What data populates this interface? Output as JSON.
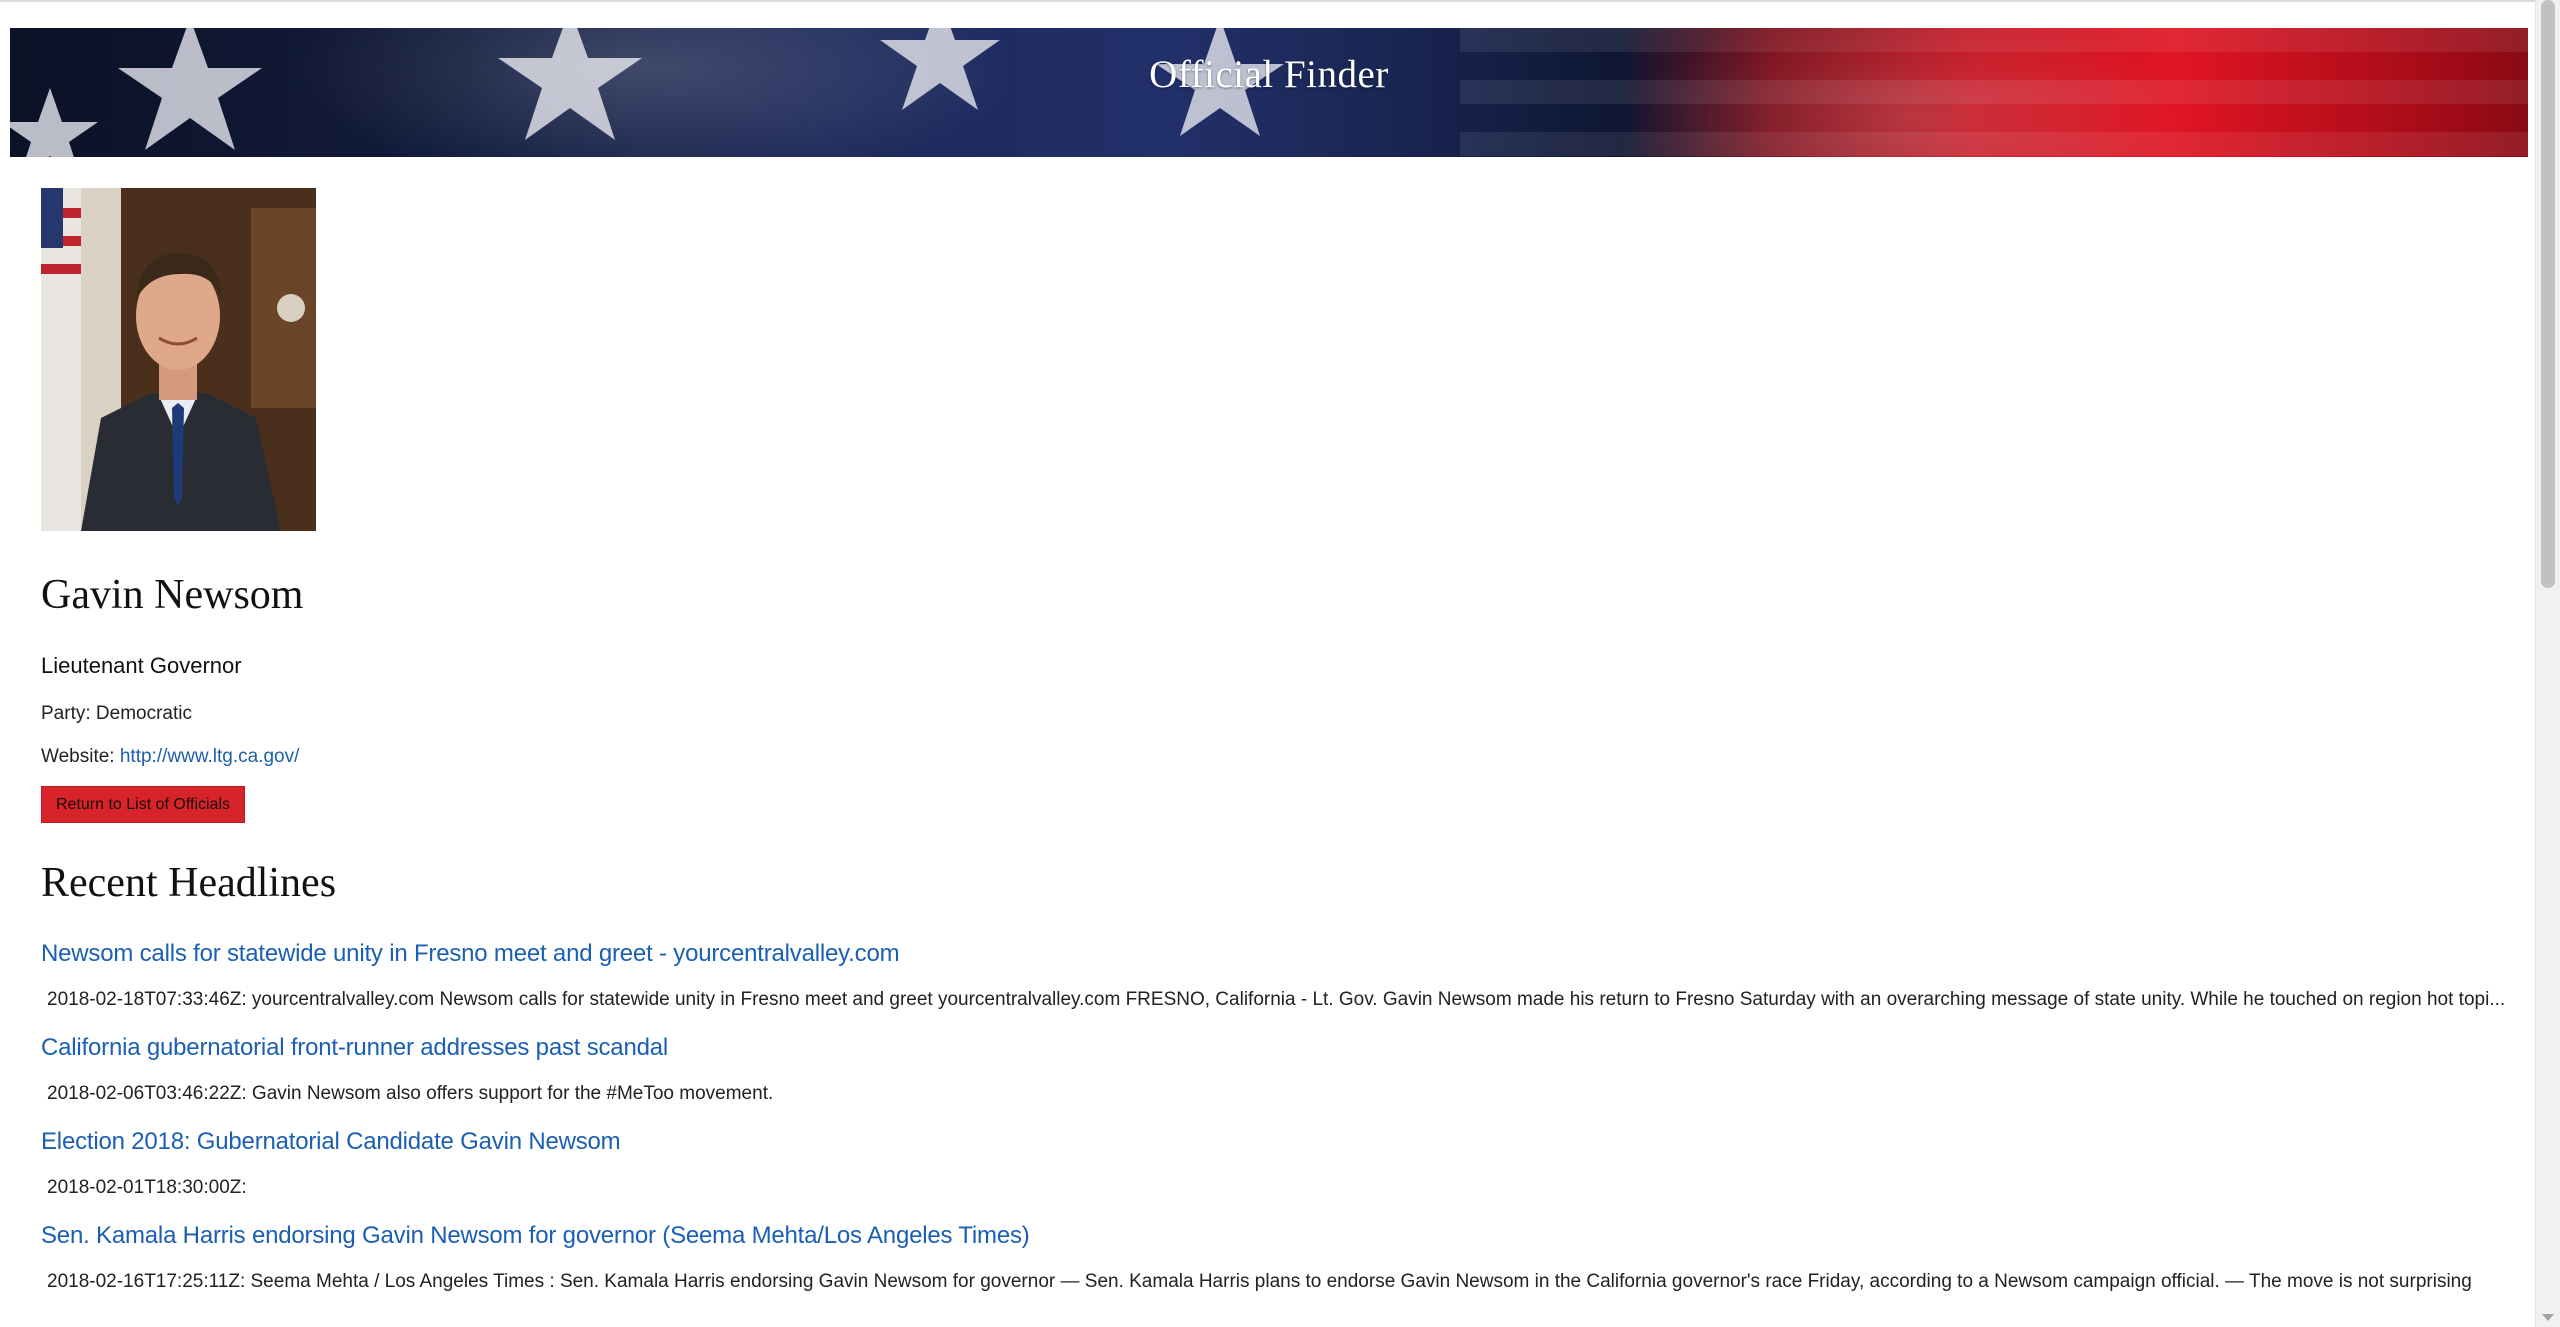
{
  "banner": {
    "title": "Official Finder"
  },
  "official": {
    "photo_alt": "portrait-photo",
    "name": "Gavin Newsom",
    "office": "Lieutenant Governor",
    "party_label": "Party:",
    "party": "Democratic",
    "website_label": "Website:",
    "website_url": "http://www.ltg.ca.gov/",
    "return_button": "Return to List of Officials"
  },
  "headlines_section": {
    "title": "Recent Headlines",
    "items": [
      {
        "title": "Newsom calls for statewide unity in Fresno meet and greet - yourcentralvalley.com",
        "description": "2018-02-18T07:33:46Z: yourcentralvalley.com Newsom calls for statewide unity in Fresno meet and greet yourcentralvalley.com FRESNO, California - Lt. Gov. Gavin Newsom made his return to Fresno Saturday with an overarching message of state unity. While he touched on region hot topi..."
      },
      {
        "title": "California gubernatorial front-runner addresses past scandal",
        "description": "2018-02-06T03:46:22Z: Gavin Newsom also offers support for the #MeToo movement."
      },
      {
        "title": "Election 2018: Gubernatorial Candidate Gavin Newsom",
        "description": "2018-02-01T18:30:00Z:"
      },
      {
        "title": "Sen. Kamala Harris endorsing Gavin Newsom for governor (Seema Mehta/Los Angeles Times)",
        "description": "2018-02-16T17:25:11Z: Seema Mehta / Los Angeles Times : Sen. Kamala Harris endorsing Gavin Newsom for governor — Sen. Kamala Harris plans to endorse Gavin Newsom in the California governor's race Friday, according to a Newsom campaign official. — The move is not surprising"
      }
    ]
  },
  "colors": {
    "link": "#1a5fb4",
    "button": "#d7242b"
  }
}
